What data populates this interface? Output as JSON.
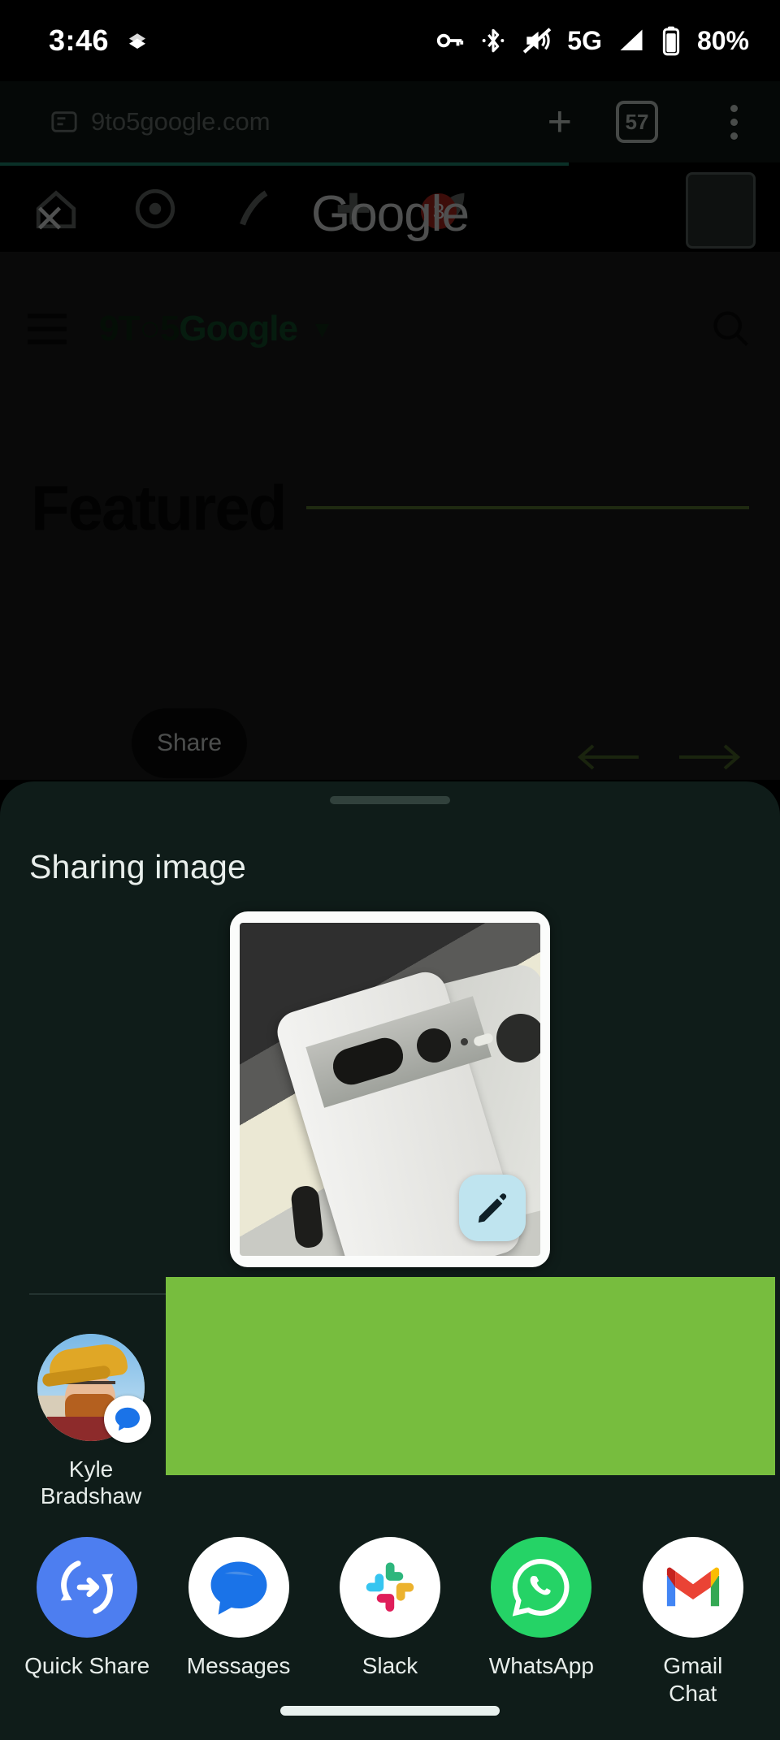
{
  "status_bar": {
    "time": "3:46",
    "notification_icon": "layers-icon",
    "icons": [
      "vpn-key-icon",
      "bluetooth-icon",
      "volume-off-icon"
    ],
    "network": "5G",
    "signal_icon": "signal-bars-icon",
    "battery_icon": "battery-icon",
    "battery_percent": "80%"
  },
  "browser": {
    "url": "9to5google.com",
    "lock_icon": "page-info-icon",
    "brand_word": "Google",
    "close_label": "✕",
    "new_tab_label": "+",
    "tab_count": "57",
    "menu_icon": "overflow-menu-icon",
    "shortcut_badge": "3",
    "shortcuts": [
      "home-icon",
      "dashboard-icon",
      "brush-icon",
      "plus-icon",
      "leaf-icon"
    ]
  },
  "site": {
    "menu_icon": "hamburger-icon",
    "logo_part1": "9T",
    "logo_clock": "○",
    "logo_part2": "5",
    "logo_part3": "Google",
    "caret_icon": "chevron-down-icon",
    "search_icon": "search-icon",
    "featured_heading": "Featured",
    "share_tooltip": "Share",
    "prev_arrow": "←",
    "next_arrow": "→"
  },
  "sheet": {
    "title": "Sharing image",
    "handle": "drag-handle",
    "edit_button_icon": "pencil-icon",
    "preview_alt": "Shared image preview of a white Pixel 7 Pro"
  },
  "direct_share": [
    {
      "name": "Kyle Bradshaw",
      "app_badge": "messages-icon"
    }
  ],
  "redaction": {
    "color": "#77bd3e",
    "label": "redaction-block"
  },
  "apps": [
    {
      "label": "Quick Share",
      "icon": "quick-share-icon"
    },
    {
      "label": "Messages",
      "icon": "messages-icon"
    },
    {
      "label": "Slack",
      "icon": "slack-icon"
    },
    {
      "label": "WhatsApp",
      "icon": "whatsapp-icon"
    },
    {
      "label": "Gmail\nChat",
      "label_line1": "Gmail",
      "label_line2": "Chat",
      "icon": "gmail-icon"
    }
  ],
  "navigation": {
    "gesture_bar": "home-gesture-bar"
  },
  "colors": {
    "sheet_background": "#0f1c19",
    "accent_blue": "#bfe4ef",
    "quick_share_blue": "#4d7ef0",
    "whatsapp_green": "#25d366",
    "redaction_green": "#77bd3e"
  }
}
